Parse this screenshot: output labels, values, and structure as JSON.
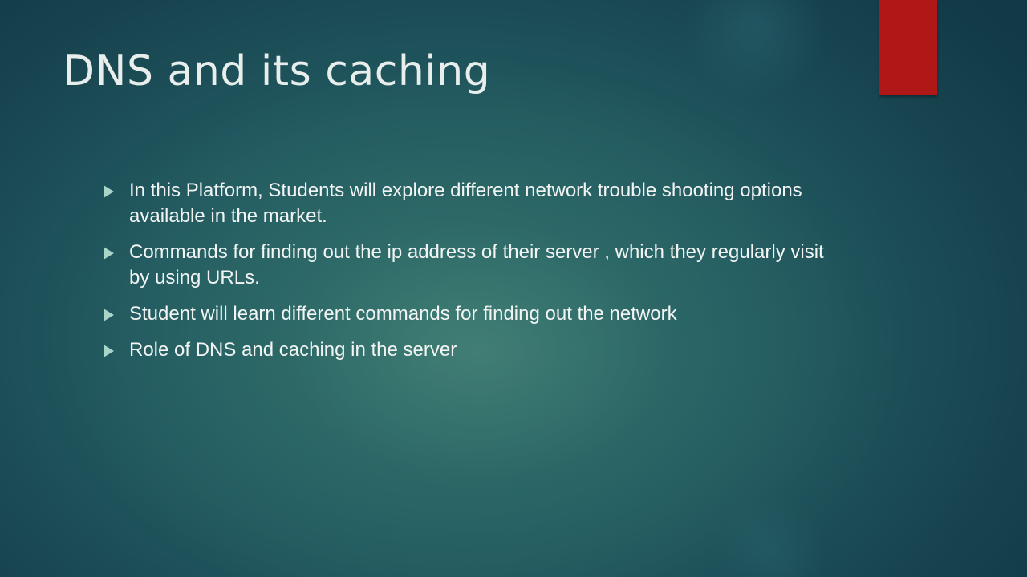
{
  "slide": {
    "title": "DNS and its caching",
    "accent_color": "#b01818",
    "bullet_icon": "triangle-arrow-icon",
    "bullets": [
      "In this Platform, Students will explore different network trouble shooting options available in the market.",
      "Commands for finding out the ip address of their server , which they regularly visit by using URLs.",
      "Student will learn different commands for finding out the network",
      "Role of DNS and caching in the server"
    ]
  }
}
